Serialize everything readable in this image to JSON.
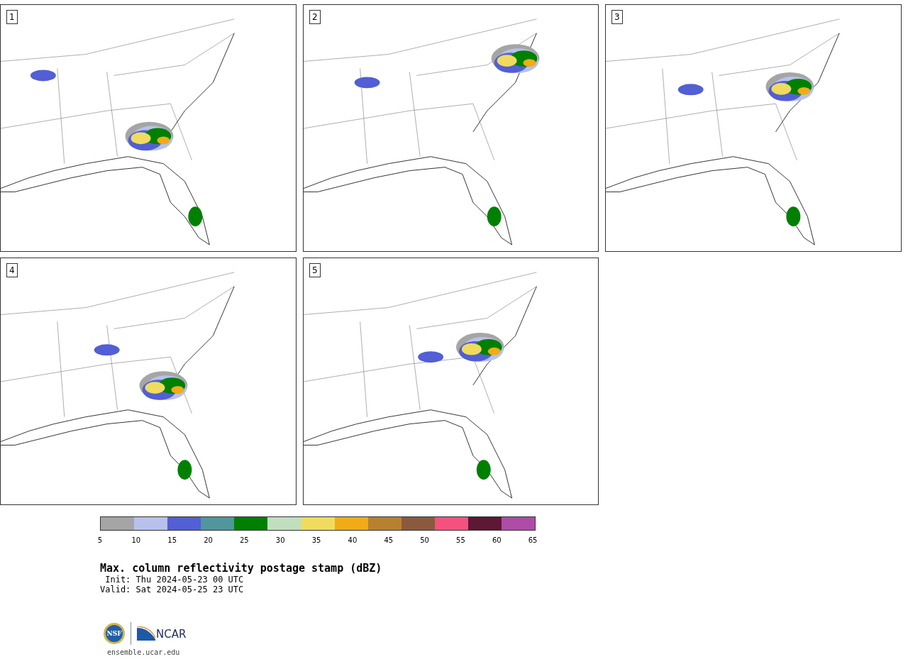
{
  "panels": [
    {
      "label": "1"
    },
    {
      "label": "2"
    },
    {
      "label": "3"
    },
    {
      "label": "4"
    },
    {
      "label": "5"
    }
  ],
  "colorbar": {
    "bins": [
      {
        "color": "#a5a5a5"
      },
      {
        "color": "#b7c1ec"
      },
      {
        "color": "#525fd5"
      },
      {
        "color": "#4f969d"
      },
      {
        "color": "#008000"
      },
      {
        "color": "#bfdfbf"
      },
      {
        "color": "#f0db5e"
      },
      {
        "color": "#f0ac17"
      },
      {
        "color": "#b8812f"
      },
      {
        "color": "#8a5a3e"
      },
      {
        "color": "#f5517e"
      },
      {
        "color": "#5e1735"
      },
      {
        "color": "#ae4ca8"
      }
    ],
    "tick_labels": [
      "5",
      "10",
      "15",
      "20",
      "25",
      "30",
      "35",
      "40",
      "45",
      "50",
      "55",
      "60",
      "65"
    ]
  },
  "title": "Max. column reflectivity postage stamp (dBZ)",
  "init": " Init: Thu 2024-05-23 00 UTC",
  "valid": "Valid: Sat 2024-05-25 23 UTC",
  "logos": {
    "left": "NSF",
    "right": "NCAR"
  },
  "site": "ensemble.ucar.edu"
}
